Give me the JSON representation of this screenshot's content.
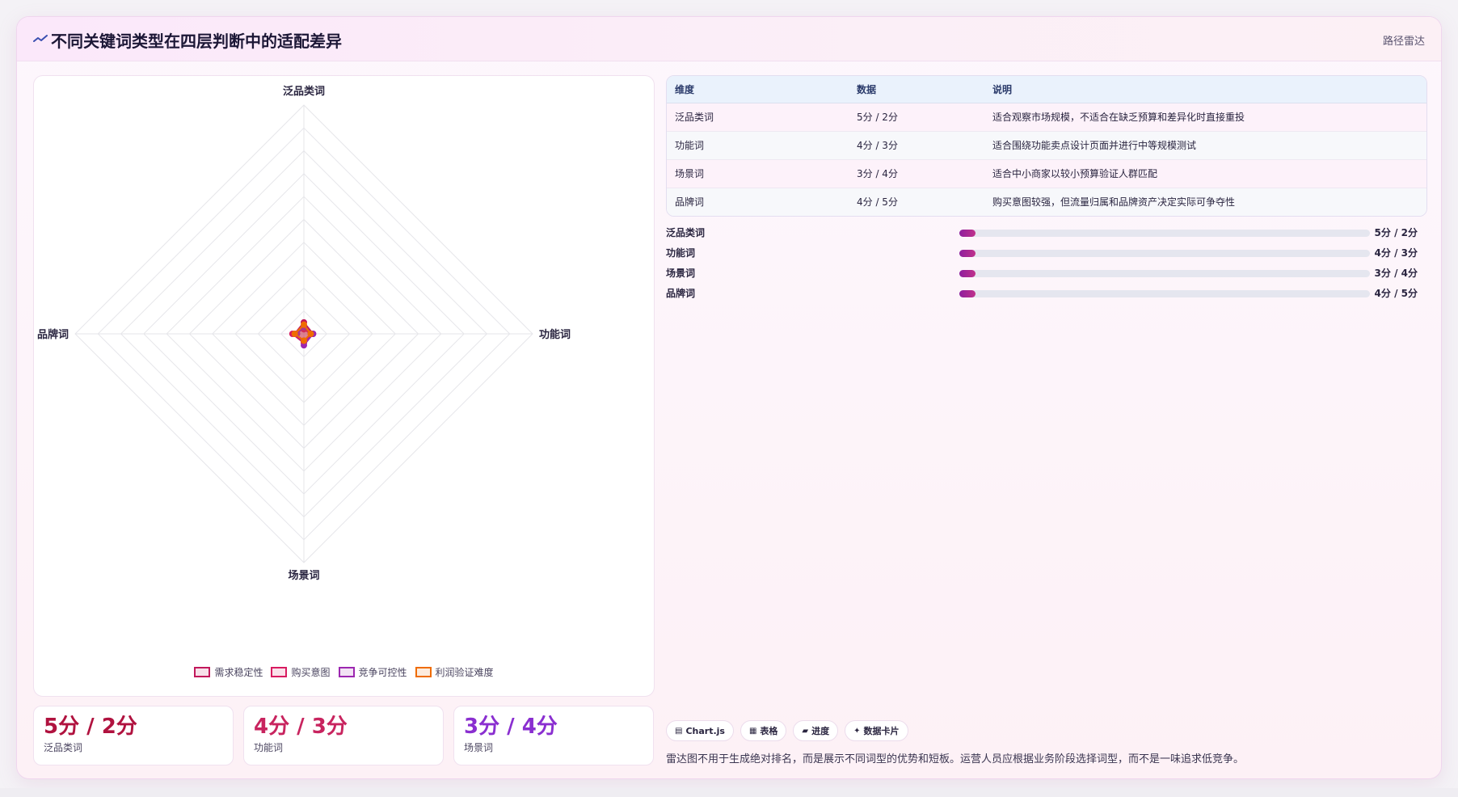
{
  "header": {
    "title": "不同关键词类型在四层判断中的适配差异",
    "tag": "路径雷达"
  },
  "chart_data": {
    "type": "radar",
    "axes": [
      "泛品类词",
      "功能词",
      "场景词",
      "品牌词"
    ],
    "max": 100,
    "series": [
      {
        "name": "需求稳定性",
        "values": [
          5,
          4,
          3,
          4
        ],
        "color": "#c2185b"
      },
      {
        "name": "购买意图",
        "values": [
          2,
          3,
          4,
          5
        ],
        "color": "#d81b60"
      },
      {
        "name": "竞争可控性",
        "values": [
          3,
          4,
          5,
          3
        ],
        "color": "#9c27b0"
      },
      {
        "name": "利润验证难度",
        "values": [
          4,
          3,
          3,
          4
        ],
        "color": "#ef6c00"
      }
    ],
    "legend_position": "bottom"
  },
  "table": {
    "headers": [
      "维度",
      "数据",
      "说明"
    ],
    "rows": [
      [
        "泛品类词",
        "5分 / 2分",
        "适合观察市场规模，不适合在缺乏预算和差异化时直接重投"
      ],
      [
        "功能词",
        "4分 / 3分",
        "适合围绕功能卖点设计页面并进行中等规模测试"
      ],
      [
        "场景词",
        "3分 / 4分",
        "适合中小商家以较小预算验证人群匹配"
      ],
      [
        "品牌词",
        "4分 / 5分",
        "购买意图较强，但流量归属和品牌资产决定实际可争夺性"
      ]
    ]
  },
  "progress": [
    {
      "label": "泛品类词",
      "value": "5分 / 2分",
      "fill": 0.04
    },
    {
      "label": "功能词",
      "value": "4分 / 3分",
      "fill": 0.04
    },
    {
      "label": "场景词",
      "value": "3分 / 4分",
      "fill": 0.04
    },
    {
      "label": "品牌词",
      "value": "4分 / 5分",
      "fill": 0.04
    }
  ],
  "stats": [
    {
      "value": "5分 / 2分",
      "label": "泛品类词",
      "color": "#b0123f"
    },
    {
      "value": "4分 / 3分",
      "label": "功能词",
      "color": "#c8245f"
    },
    {
      "value": "3分 / 4分",
      "label": "场景词",
      "color": "#8a2fd0"
    }
  ],
  "chips": [
    {
      "icon": "chart-icon",
      "glyph": "▤",
      "label": "Chart.js"
    },
    {
      "icon": "table-icon",
      "glyph": "▦",
      "label": "表格"
    },
    {
      "icon": "progress-icon",
      "glyph": "▰",
      "label": "进度"
    },
    {
      "icon": "sparkle-icon",
      "glyph": "✦",
      "label": "数据卡片"
    }
  ],
  "footnote": "雷达图不用于生成绝对排名，而是展示不同词型的优势和短板。运营人员应根据业务阶段选择词型，而不是一味追求低竞争。"
}
